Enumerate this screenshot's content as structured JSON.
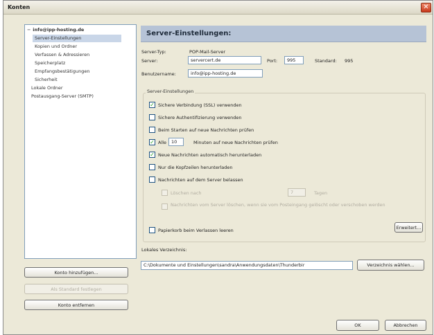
{
  "window": {
    "title": "Konten",
    "close_glyph": "✕"
  },
  "tree": {
    "items": [
      {
        "label": "info@ipp-hosting.de",
        "root": true,
        "expander": "−",
        "selected": false
      },
      {
        "label": "Server-Einstellungen",
        "selected": true
      },
      {
        "label": "Kopien und Ordner"
      },
      {
        "label": "Verfassen & Adressieren"
      },
      {
        "label": "Speicherplatz"
      },
      {
        "label": "Empfangsbestätigungen"
      },
      {
        "label": "Sicherheit"
      },
      {
        "label": "Lokale Ordner",
        "top": true
      },
      {
        "label": "Postausgang-Server (SMTP)",
        "top": true
      }
    ]
  },
  "left_buttons": {
    "add_account": "Konto hinzufügen...",
    "set_default": "Als Standard festlegen",
    "remove_account": "Konto entfernen"
  },
  "header": {
    "title": "Server-Einstellungen:"
  },
  "server": {
    "type_label": "Server-Typ:",
    "type_value": "POP-Mail-Server",
    "server_label": "Server:",
    "server_value": "servercert.de",
    "port_label": "Port:",
    "port_value": "995",
    "standard_label": "Standard:",
    "standard_value": "995",
    "user_label": "Benutzername:",
    "user_value": "info@ipp-hosting.de"
  },
  "group": {
    "title": "Server-Einstellungen",
    "ssl_label": "Sichere Verbindung (SSL) verwenden",
    "secure_auth_label": "Sichere Authentifizierung verwenden",
    "check_on_start_label": "Beim Starten auf neue Nachrichten prüfen",
    "every_label": "Alle",
    "every_value": "10",
    "minutes_label": "Minuten auf neue Nachrichten prüfen",
    "auto_download_label": "Neue Nachrichten automatisch herunterladen",
    "headers_only_label": "Nur die Kopfzeilen herunterladen",
    "leave_on_server_label": "Nachrichten auf dem Server belassen",
    "delete_after_label": "Löschen nach",
    "delete_after_value": "7",
    "days_label": "Tagen",
    "delete_from_server_label": "Nachrichten vom Server löschen, wenn sie vom Posteingang gelöscht oder verschoben werden",
    "empty_trash_label": "Papierkorb beim Verlassen leeren",
    "advanced_button": "Erweitert..."
  },
  "local": {
    "label": "Lokales Verzeichnis:",
    "path": "C:\\Dokumente und Einstellungen\\sandra\\Anwendungsdaten\\Thunderbir",
    "choose_button": "Verzeichnis wählen..."
  },
  "footer": {
    "ok": "OK",
    "cancel": "Abbrechen"
  },
  "checkmark": "✓"
}
